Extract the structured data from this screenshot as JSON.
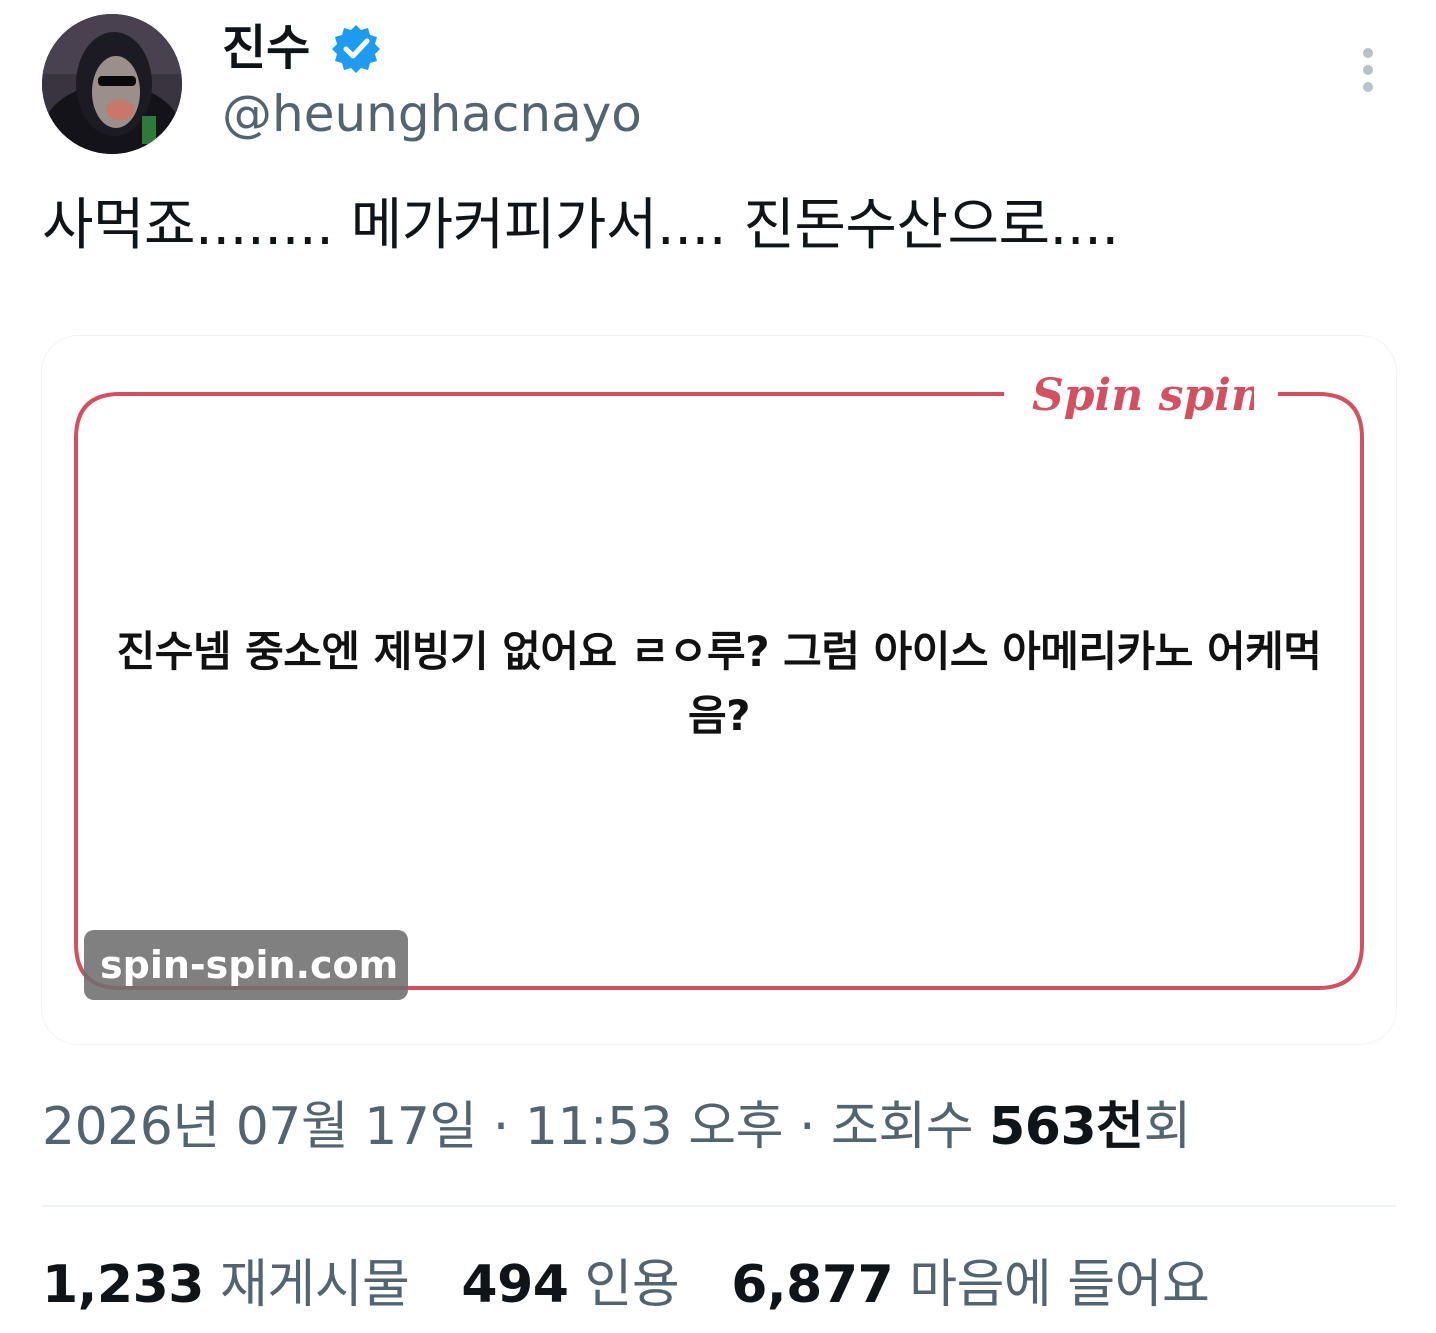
{
  "author": {
    "display_name": "진수",
    "handle": "@heunghacnayo",
    "verified_icon": "verified-badge-icon",
    "verified_color": "#1d9bf0"
  },
  "tweet": {
    "text": "사먹죠........ 메가커피가서.... 진돈수산으로...."
  },
  "media": {
    "brand_logo": "Spin spin",
    "message": "진수넴 중소엔 제빙기 없어요 ㄹㅇ루? 그럼 아이스 아메리카노 어케먹음?",
    "watermark": "spin-spin.com",
    "frame_color": "#d2505f"
  },
  "meta": {
    "date": "2026년 07월 17일",
    "sep1": " · ",
    "time": "11:53 오후",
    "sep2": " · ",
    "views_label": "조회수 ",
    "views_count": "563천",
    "views_suffix": "회"
  },
  "stats": {
    "retweets_count": "1,233",
    "retweets_label": "재게시물",
    "quotes_count": "494",
    "quotes_label": "인용",
    "likes_count": "6,877",
    "likes_label": "마음에 들어요"
  }
}
